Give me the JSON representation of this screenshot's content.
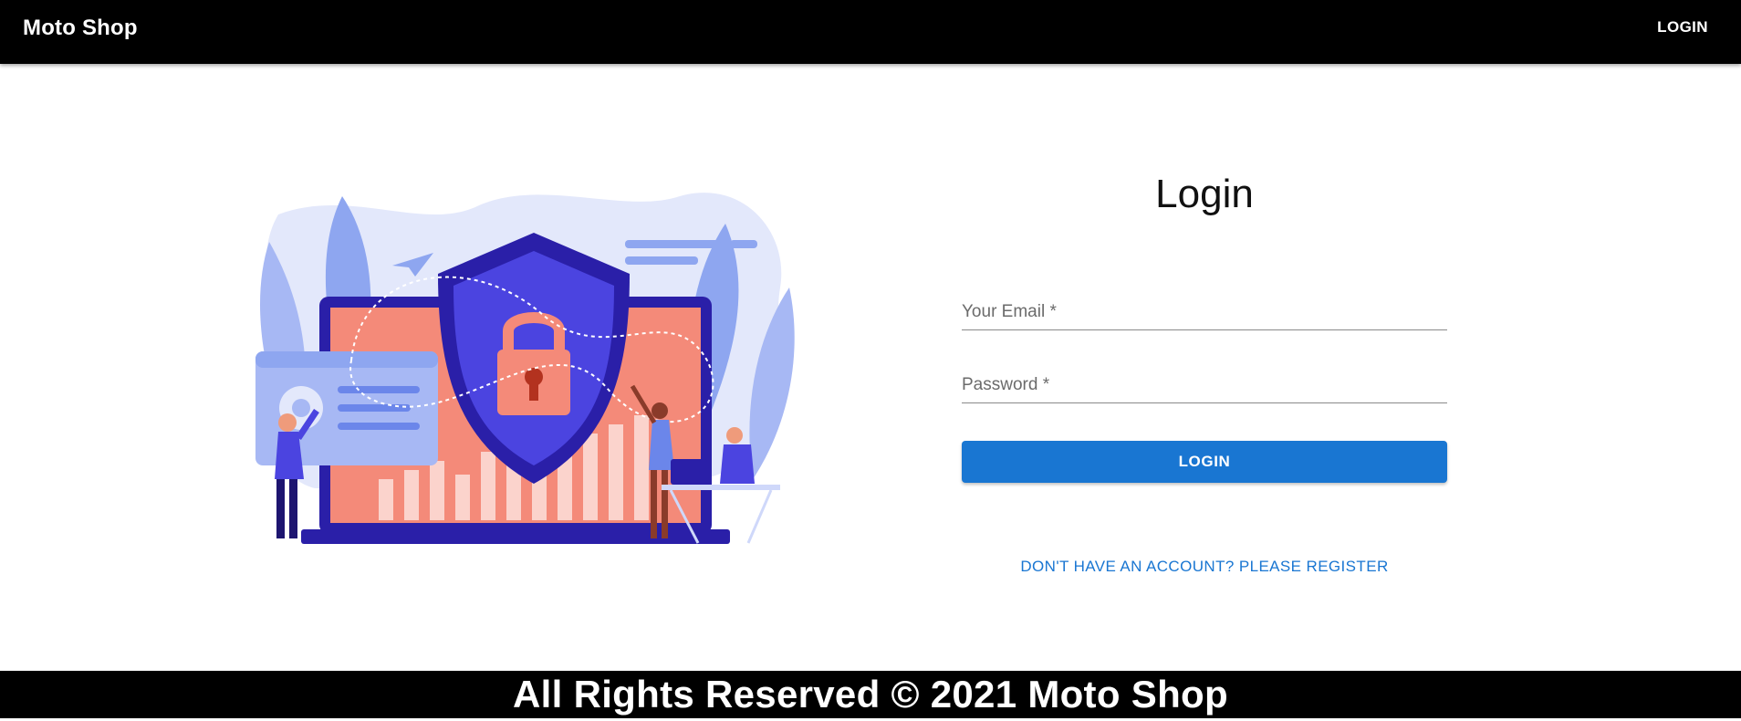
{
  "header": {
    "brand": "Moto Shop",
    "nav_login_label": "LOGIN"
  },
  "login_form": {
    "title": "Login",
    "email_label": "Your Email *",
    "email_value": "",
    "password_label": "Password *",
    "password_value": "",
    "submit_label": "LOGIN",
    "register_link_label": "DON'T HAVE AN ACCOUNT? PLEASE REGISTER"
  },
  "illustration": {
    "icon": "security-shield-lock-illustration"
  },
  "footer": {
    "text": "All Rights Reserved © 2021 Moto Shop"
  },
  "colors": {
    "appbar": "#000000",
    "primary": "#1976d2",
    "shield": "#3a2fd0",
    "screen": "#f48a79"
  }
}
